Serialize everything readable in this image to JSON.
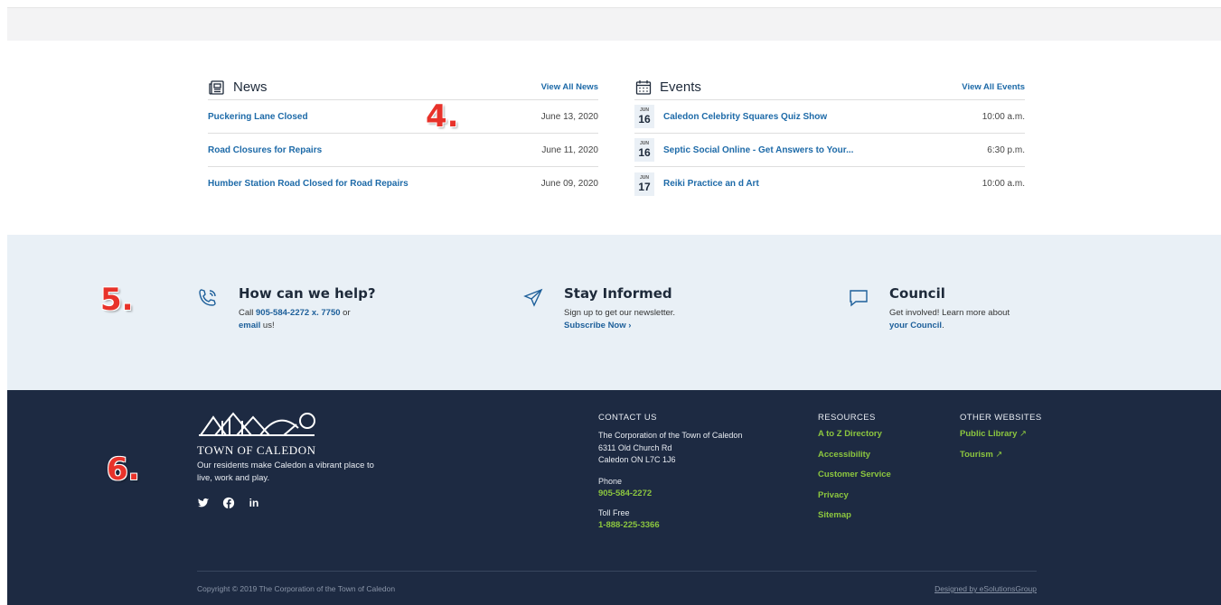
{
  "news": {
    "title": "News",
    "view_all": "View All News",
    "items": [
      {
        "title": "Puckering Lane Closed",
        "date": "June 13, 2020"
      },
      {
        "title": "Road Closures for Repairs",
        "date": "June 11, 2020"
      },
      {
        "title": "Humber Station Road Closed for Road Repairs",
        "date": "June 09, 2020"
      }
    ]
  },
  "events": {
    "title": "Events",
    "view_all": "View All Events",
    "items": [
      {
        "month": "JUN",
        "day": "16",
        "title": "Caledon Celebrity Squares Quiz Show",
        "time": "10:00 a.m."
      },
      {
        "month": "JUN",
        "day": "16",
        "title": "Septic Social Online - Get Answers to Your...",
        "time": "6:30 p.m."
      },
      {
        "month": "JUN",
        "day": "17",
        "title": "Reiki Practice an d Art",
        "time": "10:00 a.m."
      }
    ]
  },
  "markers": {
    "four": "4.",
    "five": "5.",
    "six": "6."
  },
  "help": {
    "help": {
      "title": "How can we help?",
      "call": "Call ",
      "phone": "905-584-2272 x. 7750",
      "or": " or ",
      "email": "email",
      "us": " us!"
    },
    "informed": {
      "title": "Stay Informed",
      "text": "Sign up to get our newsletter.",
      "link": "Subscribe Now ›"
    },
    "council": {
      "title": "Council",
      "text": "Get involved! Learn more about",
      "link": "your Council",
      "period": "."
    }
  },
  "footer": {
    "logo_name": "TOWN OF CALEDON",
    "tagline": "Our residents make Caledon a vibrant place to live, work and play.",
    "social": [
      "twitter-icon",
      "facebook-icon",
      "linkedin-icon"
    ],
    "contact": {
      "heading": "CONTACT US",
      "org": "The Corporation of the Town of Caledon",
      "street": "6311 Old Church Rd",
      "city": "Caledon ON L7C 1J6",
      "phone_label": "Phone",
      "phone": "905-584-2272",
      "tollfree_label": "Toll Free",
      "tollfree": "1-888-225-3366"
    },
    "resources": {
      "heading": "RESOURCES",
      "links": [
        "A to Z Directory",
        "Accessibility",
        "Customer Service",
        "Privacy",
        "Sitemap"
      ]
    },
    "other": {
      "heading": "OTHER WEBSITES",
      "links": [
        "Public Library",
        "Tourism"
      ]
    },
    "copyright": "Copyright © 2019 The Corporation of the Town of Caledon",
    "designed": "Designed by eSolutionsGroup"
  },
  "colors": {
    "accent": "#1d6aa8",
    "footer_bg": "#1d2a42",
    "green_link": "#8cc63f",
    "help_bg": "#e9f0f6",
    "marker": "#e8322a"
  }
}
